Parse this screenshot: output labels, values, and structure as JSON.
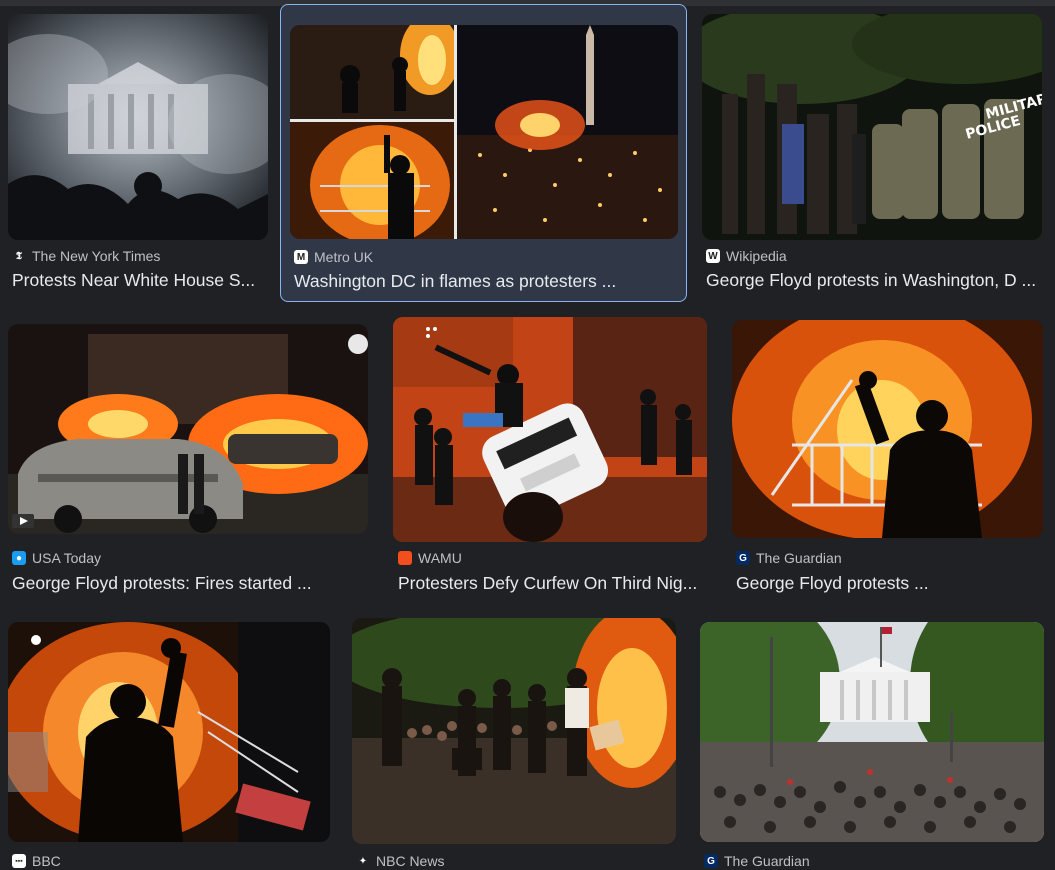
{
  "results": [
    {
      "source": "The New York Times",
      "title": "Protests Near White House S...",
      "favicon": "nyt-icon",
      "fav_color": "#ffffff",
      "fav_bg": "#202124",
      "fav_glyph": "𝕿"
    },
    {
      "source": "Metro UK",
      "title": "Washington DC in flames as protesters ...",
      "favicon": "metro-icon",
      "fav_color": "#202124",
      "fav_bg": "#ffffff",
      "fav_glyph": "M"
    },
    {
      "source": "Wikipedia",
      "title": "George Floyd protests in Washington, D ...",
      "favicon": "wikipedia-icon",
      "fav_color": "#202124",
      "fav_bg": "#ffffff",
      "fav_glyph": "W"
    },
    {
      "source": "USA Today",
      "title": "George Floyd protests: Fires started ...",
      "favicon": "usa-today-icon",
      "fav_color": "#ffffff",
      "fav_bg": "#1a9cf0",
      "fav_glyph": "●"
    },
    {
      "source": "WAMU",
      "title": "Protesters Defy Curfew On Third Nig...",
      "favicon": "wamu-icon",
      "fav_color": "#ffffff",
      "fav_bg": "#f24e1e",
      "fav_glyph": ""
    },
    {
      "source": "The Guardian",
      "title": "George Floyd protests ...",
      "favicon": "guardian-icon",
      "fav_color": "#ffffff",
      "fav_bg": "#052962",
      "fav_glyph": "G"
    },
    {
      "source": "BBC",
      "title": "",
      "favicon": "bbc-icon",
      "fav_color": "#202124",
      "fav_bg": "#ffffff",
      "fav_glyph": "▪▪▪"
    },
    {
      "source": "NBC News",
      "title": "",
      "favicon": "nbc-icon",
      "fav_color": "#ffffff",
      "fav_bg": "#202124",
      "fav_glyph": "✦"
    },
    {
      "source": "The Guardian",
      "title": "",
      "favicon": "guardian-icon",
      "fav_color": "#ffffff",
      "fav_bg": "#052962",
      "fav_glyph": "G"
    }
  ]
}
